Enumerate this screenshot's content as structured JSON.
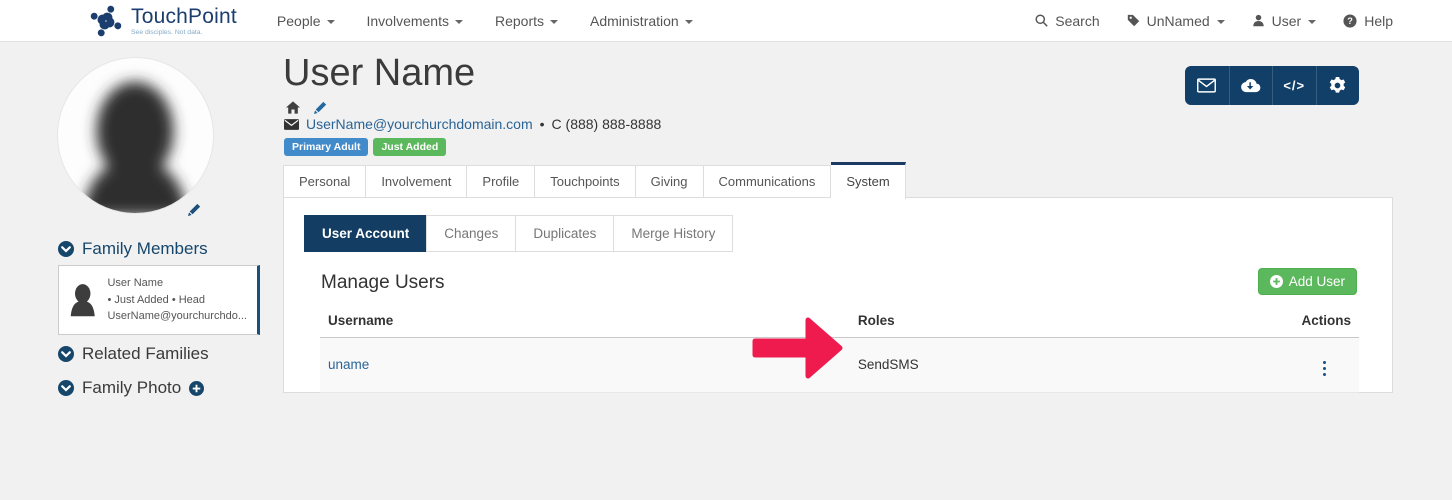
{
  "nav": {
    "brand": {
      "name": "TouchPoint",
      "tagline": "See disciples. Not data."
    },
    "menus": [
      "People",
      "Involvements",
      "Reports",
      "Administration"
    ],
    "right": {
      "search": "Search",
      "tag": "UnNamed",
      "user": "User",
      "help": "Help"
    }
  },
  "person": {
    "name": "User Name",
    "email": "UserName@yourchurchdomain.com",
    "separator": "•",
    "phone": "C (888) 888-8888",
    "badges": [
      "Primary Adult",
      "Just Added"
    ]
  },
  "sidebar": {
    "family_members": "Family Members",
    "member": {
      "name": "User Name",
      "meta": "• Just Added • Head",
      "email": "UserName@yourchurchdo..."
    },
    "related_families": "Related Families",
    "family_photo": "Family Photo"
  },
  "tabs": [
    "Personal",
    "Involvement",
    "Profile",
    "Touchpoints",
    "Giving",
    "Communications",
    "System"
  ],
  "subtabs": [
    "User Account",
    "Changes",
    "Duplicates",
    "Merge History"
  ],
  "manage": {
    "title": "Manage Users",
    "add_label": "Add User",
    "columns": [
      "Username",
      "Roles",
      "Actions"
    ],
    "rows": [
      {
        "username": "uname",
        "roles": "SendSMS"
      }
    ]
  },
  "glyphs": {
    "code": "</>"
  },
  "colors": {
    "navy": "#113f68",
    "tab_accent": "#1b3a64",
    "badge_blue": "#428bca",
    "green": "#5cb85c",
    "link_blue": "#2a6496",
    "arrow_red": "#ef1a4d"
  }
}
